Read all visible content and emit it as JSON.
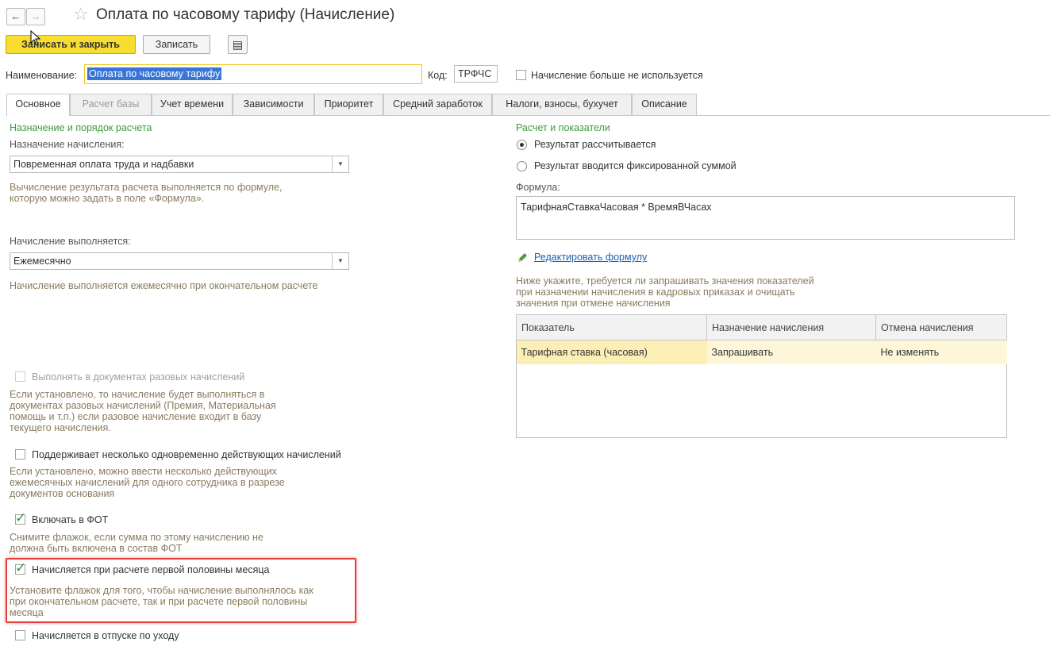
{
  "header": {
    "back_glyph": "←",
    "forward_glyph": "→",
    "star_glyph": "☆",
    "title": "Оплата по часовому тарифу (Начисление)"
  },
  "toolbar": {
    "save_close_label": "Записать и закрыть",
    "save_label": "Записать",
    "report_glyph": "▤"
  },
  "form": {
    "name_label": "Наименование:",
    "name_value": "Оплата по часовому тарифу",
    "code_label": "Код:",
    "code_value": "ТРФЧС",
    "unused_label": "Начисление больше не используется"
  },
  "tabs": [
    {
      "label": "Основное",
      "active": true
    },
    {
      "label": "Расчет базы",
      "disabled": true
    },
    {
      "label": "Учет времени"
    },
    {
      "label": "Зависимости"
    },
    {
      "label": "Приоритет"
    },
    {
      "label": "Средний заработок"
    },
    {
      "label": "Налоги, взносы, бухучет"
    },
    {
      "label": "Описание"
    }
  ],
  "left": {
    "section_title": "Назначение и порядок расчета",
    "purpose_label": "Назначение начисления:",
    "purpose_value": "Повременная оплата труда и надбавки",
    "purpose_hint_1": "Вычисление результата расчета выполняется по формуле,",
    "purpose_hint_2": "которую можно задать в поле «Формула».",
    "period_label": "Начисление выполняется:",
    "period_value": "Ежемесячно",
    "period_hint": "Начисление выполняется ежемесячно при окончательном расчете",
    "onetime_label": "Выполнять в документах разовых начислений",
    "onetime_hint": [
      "Если установлено, то начисление будет выполняться в",
      "документах разовых начислений (Премия, Материальная",
      "помощь и т.п.) если разовое начисление входит в базу",
      "текущего начисления."
    ],
    "multi_label": "Поддерживает несколько одновременно действующих начислений",
    "multi_hint": [
      "Если установлено, можно ввести несколько действующих",
      "ежемесячных начислений для одного сотрудника в разрезе",
      "документов основания"
    ],
    "fot_label": "Включать в ФОТ",
    "fot_hint": [
      "Снимите флажок, если сумма по этому начислению не",
      "должна быть включена в состав ФОТ"
    ],
    "firsthalf_label": "Начисляется при расчете первой половины месяца",
    "firsthalf_hint": [
      "Установите флажок для того, чтобы начисление выполнялось как",
      "при окончательном расчете, так и при расчете первой половины",
      "месяца"
    ],
    "leave_label": "Начисляется в отпуске по уходу"
  },
  "right": {
    "section_title": "Расчет и показатели",
    "radio_calc": "Результат рассчитывается",
    "radio_fixed": "Результат вводится фиксированной суммой",
    "formula_label": "Формула:",
    "formula_value": "ТарифнаяСтавкаЧасовая * ВремяВЧасах",
    "edit_formula_link": "Редактировать формулу",
    "indicators_hint": [
      "Ниже укажите, требуется ли запрашивать значения показателей",
      "при назначении начисления в кадровых приказах и очищать",
      "значения при отмене начисления"
    ],
    "table": {
      "headers": [
        "Показатель",
        "Назначение начисления",
        "Отмена начисления"
      ],
      "rows": [
        [
          "Тарифная ставка (часовая)",
          "Запрашивать",
          "Не изменять"
        ]
      ]
    }
  },
  "colors": {
    "accent_yellow": "#f7dd2e",
    "section_green": "#3d9b3d",
    "hint_brown": "#8a7a5e",
    "highlight_red": "#e53b3b",
    "row_highlight": "#fbefb6"
  }
}
